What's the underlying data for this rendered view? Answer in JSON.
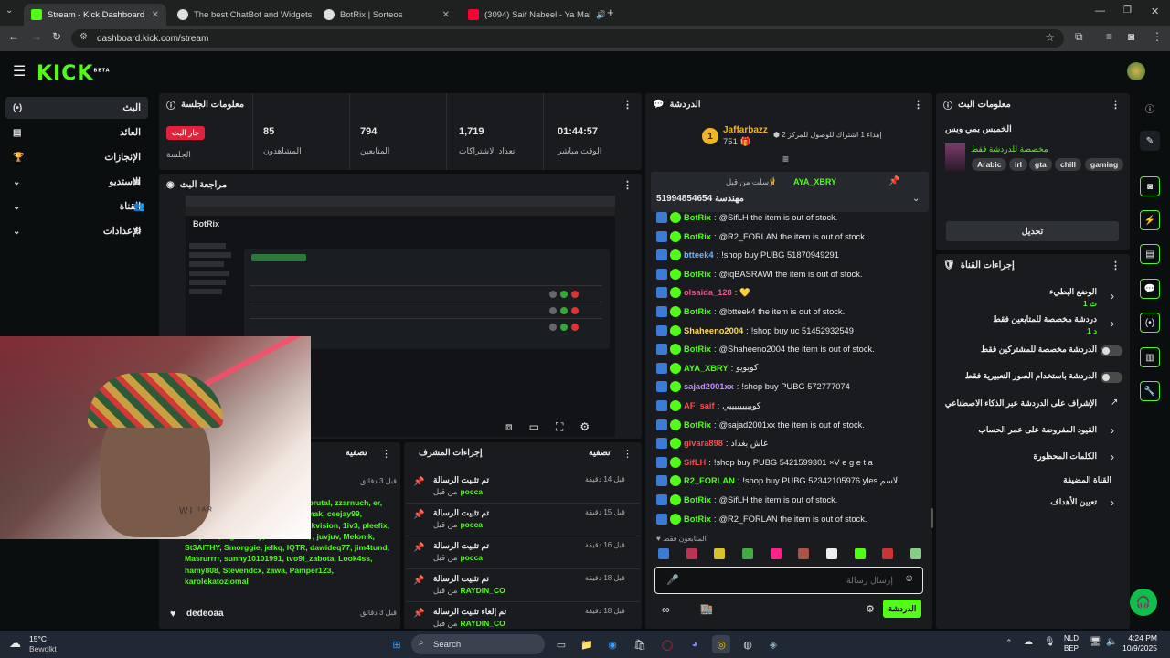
{
  "browser": {
    "tabs": [
      {
        "title": "Stream - Kick Dashboard",
        "active": true
      },
      {
        "title": "The best ChatBot and Widgets"
      },
      {
        "title": "BotRix | Sorteos"
      },
      {
        "title": "(3094) Saif Nabeel - Ya Mal"
      }
    ],
    "url": "dashboard.kick.com/stream"
  },
  "kick": {
    "logo": "KICK",
    "beta": "BETA"
  },
  "sidebar": {
    "items": [
      {
        "label": "البث"
      },
      {
        "label": "العائد"
      },
      {
        "label": "الإنجازات"
      },
      {
        "label": "الاستديو"
      },
      {
        "label": "القناة"
      },
      {
        "label": "الإعدادات"
      }
    ]
  },
  "session": {
    "title": "معلومات الجلسة",
    "live_badge": "جار البث",
    "session_label": "الجلسة",
    "viewers_value": "85",
    "viewers_label": "المشاهدون",
    "followers_value": "794",
    "followers_label": "المتابعين",
    "subs_value": "1,719",
    "subs_label": "تعداد الاشتراكات",
    "time_value": "01:44:57",
    "time_label": "الوقت مباشر"
  },
  "preview": {
    "title": "مراجعة البث"
  },
  "filter_left": {
    "label": "تصفية",
    "time": "قبل 3 دقائق",
    "names": "e, ewic, Tommybopp, nv32d, staybrutal, zzarnuch, er, wsilketmoar, AnthoPreg, doctorsmak, ceejay99, Lemmletasteit, oldmamabruja8, mkvision, 1iv3, pleefix, Senpairu, bigfriendly, thestud940, , juvjuv, Melonik, St3AlTHY, Smorggie, jelkq, IQTR, dawideq77, jim4tund, Masrurrrr, sunny10101991, tvo9l_zabota, Look4ss, hamy808, Stevendcx, zawa, Pamper123, karolekatoziomal",
    "footer_user": "dedeoaa",
    "footer_time": "قبل 3 دقائق"
  },
  "mod": {
    "title": "إجراءات المشرف",
    "filter": "تصفية",
    "items": [
      {
        "action": "تم تثبيت الرسالة",
        "by": "من قبل",
        "user": "pocca",
        "time": "قبل 14 دقيقة"
      },
      {
        "action": "تم تثبيت الرسالة",
        "by": "من قبل",
        "user": "pocca",
        "time": "قبل 15 دقيقة"
      },
      {
        "action": "تم تثبيت الرسالة",
        "by": "من قبل",
        "user": "pocca",
        "time": "قبل 16 دقيقة"
      },
      {
        "action": "تم تثبيت الرسالة",
        "by": "من قبل",
        "user": "RAYDIN_CO",
        "time": "قبل 18 دقيقة"
      },
      {
        "action": "تم إلغاء تثبيت الرسالة",
        "by": "من قبل",
        "user": "RAYDIN_CO",
        "time": "قبل 18 دقيقة"
      }
    ]
  },
  "chat": {
    "title": "الدردشة",
    "top_rank": "1",
    "top_user": "Jaffarbazz",
    "top_amount": "751",
    "gift_text": "إهداء 1 اشتراك للوصول للمركز 2",
    "pinned_label": "أرسلت من قبل",
    "pinned_user": "AYA_XBRY",
    "pinned_text": "51994854654 مهندسة",
    "messages": [
      {
        "user": "BotRix",
        "text": "@SifLH the item is out of stock.",
        "color": "#53fc18"
      },
      {
        "user": "BotRix",
        "text": "@R2_FORLAN the item is out of stock.",
        "color": "#53fc18"
      },
      {
        "user": "btteek4",
        "text": "!shop buy PUBG 51870949291",
        "color": "#6bb6ff"
      },
      {
        "user": "BotRix",
        "text": "@iqBASRAWI the item is out of stock.",
        "color": "#53fc18"
      },
      {
        "user": "olsaida_128",
        "text": "💛",
        "color": "#e05a8a"
      },
      {
        "user": "BotRix",
        "text": "@btteek4 the item is out of stock.",
        "color": "#53fc18"
      },
      {
        "user": "Shaheeno2004",
        "text": "!shop buy uc 51452932549",
        "color": "#ffd94a"
      },
      {
        "user": "BotRix",
        "text": "@Shaheeno2004 the item is out of stock.",
        "color": "#53fc18"
      },
      {
        "user": "AYA_XBRY",
        "text": "كويويو",
        "color": "#53fc18"
      },
      {
        "user": "sajad2001xx",
        "text": "!shop buy PUBG 572777074",
        "color": "#c58cff"
      },
      {
        "user": "AF_saif",
        "text": "كويييييييييي",
        "color": "#ff4a4a"
      },
      {
        "user": "BotRix",
        "text": "@sajad2001xx the item is out of stock.",
        "color": "#53fc18"
      },
      {
        "user": "givara898",
        "text": "عاش بغداد",
        "color": "#ff4a4a"
      },
      {
        "user": "SifLH",
        "text": "!shop buy PUBG 5421599301 ×V e g e t a",
        "color": "#ff4a4a"
      },
      {
        "user": "R2_FORLAN",
        "text": "!shop buy PUBG 52342105976 yles الاسم",
        "color": "#53fc18"
      },
      {
        "user": "BotRix",
        "text": "@SifLH the item is out of stock.",
        "color": "#53fc18"
      },
      {
        "user": "BotRix",
        "text": "@R2_FORLAN the item is out of stock.",
        "color": "#53fc18"
      }
    ],
    "followers_only": "المتابعون فقط",
    "input_placeholder": "إرسال رسالة",
    "send_label": "الدردشة"
  },
  "stream_info": {
    "title": "معلومات البث",
    "stream_title": "الخميس يمي ويس",
    "category": "مخصصة للدردشة فقط",
    "tags": [
      "gaming",
      "chill",
      "gta",
      "irl",
      "Arabic"
    ],
    "edit_button": "تحديل"
  },
  "channel": {
    "title": "إجراءات القناة",
    "rows": [
      {
        "label": "الوضع البطيء",
        "sub": "1 ث"
      },
      {
        "label": "دردشة مخصصة للمتابعين فقط",
        "sub": "1 د"
      },
      {
        "label": "الدردشة مخصصة للمشتركين فقط"
      },
      {
        "label": "الدردشة باستخدام الصور التعبيرية فقط"
      },
      {
        "label": "الإشراف على الدردشة عبر الذكاء الاصطناعي"
      },
      {
        "label": "القيود المفروضة على عمر الحساب"
      },
      {
        "label": "الكلمات المحظورة"
      },
      {
        "label": "القناة المضيفة"
      },
      {
        "label": "تعيين الأهداف"
      }
    ]
  },
  "camera_overlay": "WI ᴵᴬᴿ",
  "taskbar": {
    "weather_temp": "15°C",
    "weather_desc": "Bewolkt",
    "search_placeholder": "Search",
    "lang1": "NLD",
    "lang2": "BEP",
    "time": "4:24 PM",
    "date": "10/9/2025"
  }
}
